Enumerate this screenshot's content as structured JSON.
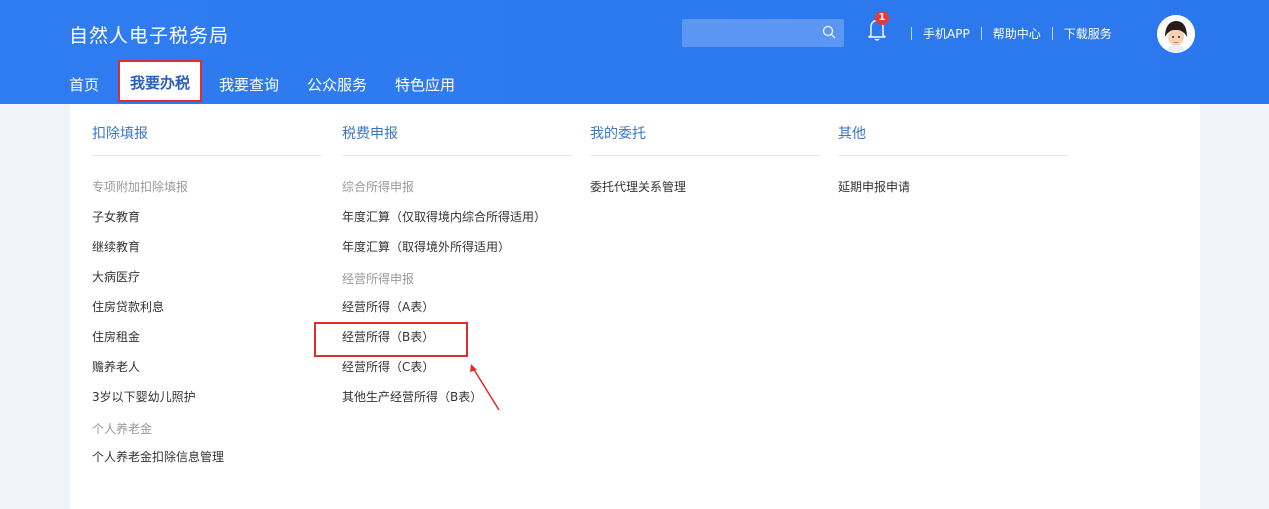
{
  "header": {
    "brand": "自然人电子税务局",
    "nav": [
      "首页",
      "我要办税",
      "我要查询",
      "公众服务",
      "特色应用"
    ],
    "notification_count": "1",
    "links": [
      "手机APP",
      "帮助中心",
      "下载服务"
    ]
  },
  "menu": {
    "col1": {
      "title": "扣除填报",
      "group1": "专项附加扣除填报",
      "items1": [
        "子女教育",
        "继续教育",
        "大病医疗",
        "住房贷款利息",
        "住房租金",
        "赡养老人",
        "3岁以下婴幼儿照护"
      ],
      "group2": "个人养老金",
      "items2": [
        "个人养老金扣除信息管理"
      ]
    },
    "col2": {
      "title": "税费申报",
      "group1": "综合所得申报",
      "items1": [
        "年度汇算（仅取得境内综合所得适用）",
        "年度汇算（取得境外所得适用）"
      ],
      "group2": "经营所得申报",
      "items2": [
        "经营所得（A表）",
        "经营所得（B表）",
        "经营所得（C表）",
        "其他生产经营所得（B表）"
      ]
    },
    "col3": {
      "title": "我的委托",
      "items": [
        "委托代理关系管理"
      ]
    },
    "col4": {
      "title": "其他",
      "items": [
        "延期申报申请"
      ]
    }
  }
}
